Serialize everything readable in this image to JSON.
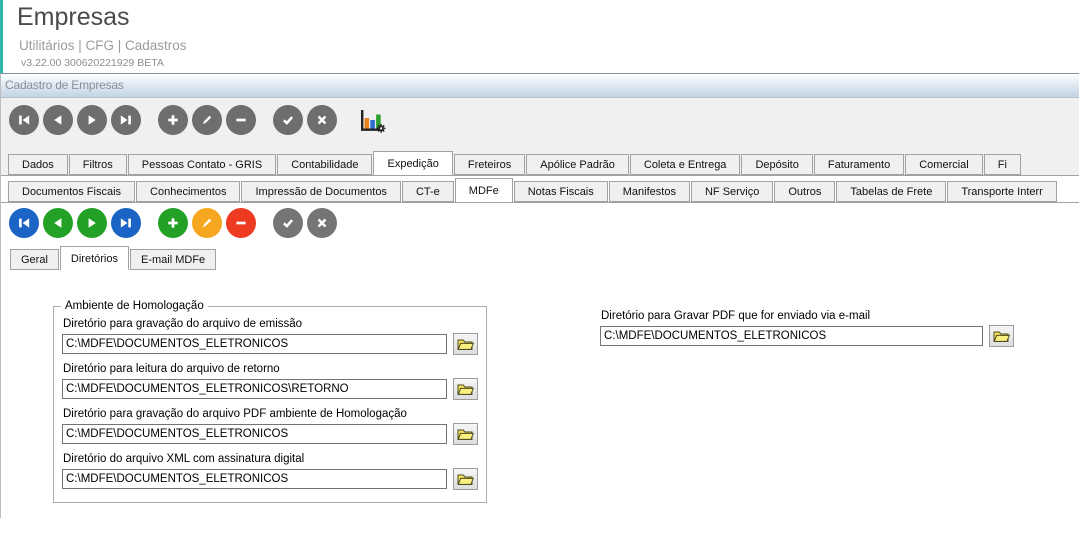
{
  "app": {
    "title": "Empresas",
    "menu_trail": "Utilitários | CFG | Cadastros",
    "version": "v3.22.00 300620221929 BETA"
  },
  "window": {
    "title": "Cadastro de Empresas"
  },
  "toolbar_main": {
    "buttons": [
      {
        "name": "first",
        "glyph": "first",
        "color": "#6e6e6e"
      },
      {
        "name": "previous",
        "glyph": "prev",
        "color": "#6e6e6e"
      },
      {
        "name": "next",
        "glyph": "next",
        "color": "#6e6e6e"
      },
      {
        "name": "last",
        "glyph": "last",
        "color": "#6e6e6e"
      },
      {
        "name": "add",
        "glyph": "add",
        "color": "#6e6e6e"
      },
      {
        "name": "edit",
        "glyph": "edit",
        "color": "#6e6e6e"
      },
      {
        "name": "delete",
        "glyph": "remove",
        "color": "#6e6e6e"
      },
      {
        "name": "confirm",
        "glyph": "check",
        "color": "#6e6e6e"
      },
      {
        "name": "cancel",
        "glyph": "cross",
        "color": "#6e6e6e"
      }
    ],
    "has_chart_button": true
  },
  "toolbar_mdfe": {
    "buttons": [
      {
        "name": "first",
        "glyph": "first",
        "color": "#1b64c5"
      },
      {
        "name": "previous",
        "glyph": "prev",
        "color": "#23a127"
      },
      {
        "name": "next",
        "glyph": "next",
        "color": "#23a127"
      },
      {
        "name": "last",
        "glyph": "last",
        "color": "#1b64c5"
      },
      {
        "name": "add",
        "glyph": "add",
        "color": "#23a127"
      },
      {
        "name": "edit",
        "glyph": "edit",
        "color": "#f6a71f"
      },
      {
        "name": "delete",
        "glyph": "remove",
        "color": "#ee3a21"
      },
      {
        "name": "confirm",
        "glyph": "check",
        "color": "#757575"
      },
      {
        "name": "cancel",
        "glyph": "cross",
        "color": "#757575"
      }
    ]
  },
  "tabs_level1": {
    "active": "Expedição",
    "items": [
      "Dados",
      "Filtros",
      "Pessoas Contato - GRIS",
      "Contabilidade",
      "Expedição",
      "Freteiros",
      "Apólice Padrão",
      "Coleta e Entrega",
      "Depósito",
      "Faturamento",
      "Comercial",
      "Fi"
    ]
  },
  "tabs_level2": {
    "active": "MDFe",
    "items": [
      "Documentos Fiscais",
      "Conhecimentos",
      "Impressão de Documentos",
      "CT-e",
      "MDFe",
      "Notas Fiscais",
      "Manifestos",
      "NF Serviço",
      "Outros",
      "Tabelas de Frete",
      "Transporte Interr"
    ]
  },
  "tabs_level3": {
    "active": "Diretórios",
    "items": [
      "Geral",
      "Diretórios",
      "E-mail MDFe"
    ]
  },
  "form": {
    "group_title": "Ambiente de Homologação",
    "fields": [
      {
        "id": "emissao",
        "label": "Diretório para gravação do arquivo de emissão",
        "value": "C:\\MDFE\\DOCUMENTOS_ELETRONICOS"
      },
      {
        "id": "retorno",
        "label": "Diretório para leitura do arquivo de retorno",
        "value": "C:\\MDFE\\DOCUMENTOS_ELETRONICOS\\RETORNO"
      },
      {
        "id": "pdf-homologacao",
        "label": "Diretório para gravação do arquivo PDF ambiente de Homologação",
        "value": "C:\\MDFE\\DOCUMENTOS_ELETRONICOS"
      },
      {
        "id": "xml-assinatura",
        "label": "Diretório do arquivo XML com assinatura digital",
        "value": "C:\\MDFE\\DOCUMENTOS_ELETRONICOS"
      }
    ],
    "email_pdf": {
      "id": "pdf-email",
      "label": "Diretório para Gravar PDF que for enviado via e-mail",
      "value": "C:\\MDFE\\DOCUMENTOS_ELETRONICOS"
    }
  },
  "colors": {
    "accent_teal": "#2fb5a8",
    "toolbar_gray": "#6e6e6e",
    "nav_blue": "#1b64c5",
    "action_green": "#23a127",
    "edit_orange": "#f6a71f",
    "delete_red": "#ee3a21",
    "folder_yellow": "#f3e25a"
  }
}
